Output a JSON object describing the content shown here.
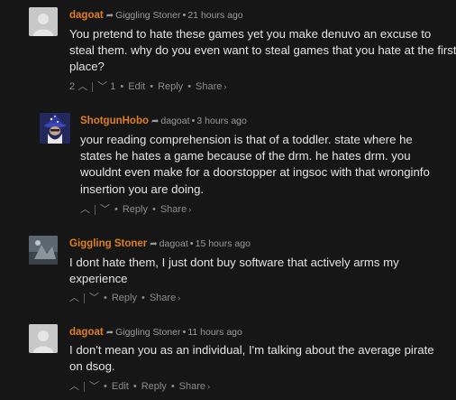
{
  "comments": [
    {
      "author": "dagoat",
      "reply_to": "Giggling Stoner",
      "time": "21 hours ago",
      "body": "You pretend to hate these games yet you make denuvo an excuse to steal them. why do you even want to steal games that you hate at the first place?",
      "upvotes": "2",
      "downvotes": "1",
      "edit_label": "Edit",
      "reply_label": "Reply",
      "share_label": "Share"
    },
    {
      "author": "ShotgunHobo",
      "reply_to": "dagoat",
      "time": "3 hours ago",
      "body": "your reading comprehension is that of a toddler. state where he states he hates a game because of the drm. he hates drm. you wouldnt even make for a doorstopper at ingsoc with that wronginfo insertion you are doing.",
      "reply_label": "Reply",
      "share_label": "Share"
    },
    {
      "author": "Giggling Stoner",
      "reply_to": "dagoat",
      "time": "15 hours ago",
      "body": "I dont hate them, I just dont buy software that actively arms my experience",
      "reply_label": "Reply",
      "share_label": "Share"
    },
    {
      "author": "dagoat",
      "reply_to": "Giggling Stoner",
      "time": "11 hours ago",
      "body": "I don't mean you as an individual, I'm talking about the average pirate on dsog.",
      "edit_label": "Edit",
      "reply_label": "Reply",
      "share_label": "Share"
    }
  ],
  "icons": {
    "reply_arrow": "reply-arrow-icon",
    "upvote": "chevron-up-icon",
    "downvote": "chevron-down-icon",
    "share_chevron": "chevron-right-icon"
  },
  "colors": {
    "background": "#161616",
    "author": "#e07f24",
    "meta": "#9a9a9a",
    "text": "#e4e4e4"
  }
}
